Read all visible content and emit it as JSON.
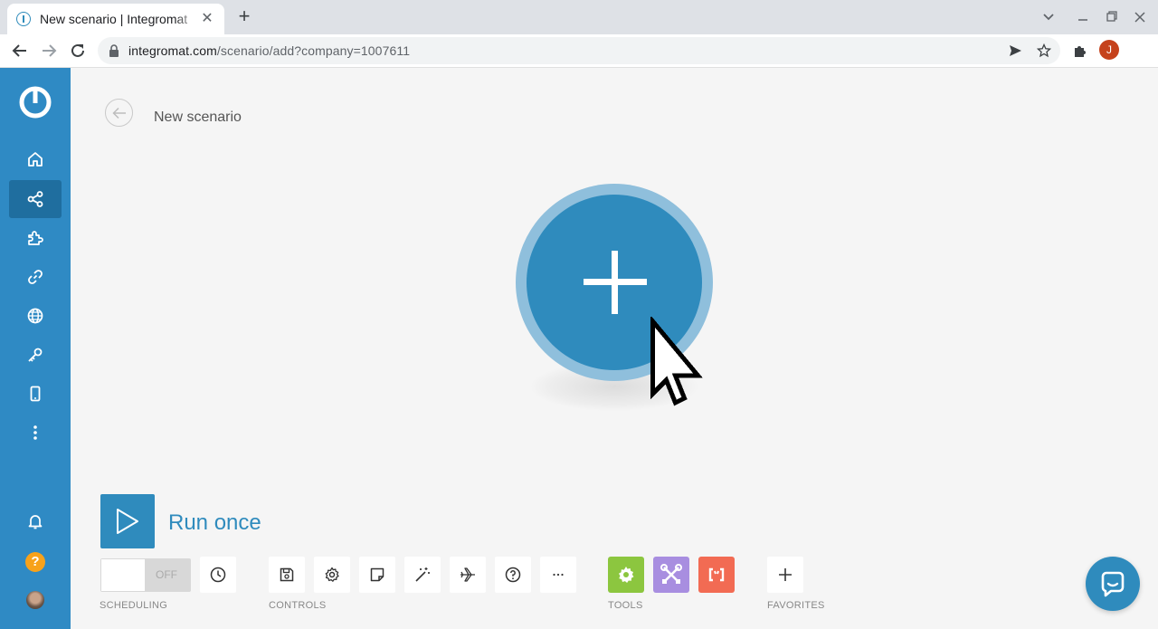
{
  "browser": {
    "tab_title": "New scenario | Integromat",
    "url_host": "integromat.com",
    "url_path": "/scenario/add?company=1007611",
    "profile_initial": "J"
  },
  "sidebar": {
    "items": [
      {
        "icon": "home-icon"
      },
      {
        "icon": "share-icon",
        "active": true
      },
      {
        "icon": "puzzle-icon"
      },
      {
        "icon": "link-icon"
      },
      {
        "icon": "globe-icon"
      },
      {
        "icon": "key-icon"
      },
      {
        "icon": "mobile-icon"
      },
      {
        "icon": "more-vertical-icon"
      }
    ],
    "bottom": [
      {
        "icon": "bell-icon"
      },
      {
        "icon": "help-circle-icon",
        "label": "?"
      },
      {
        "icon": "user-avatar"
      }
    ]
  },
  "header": {
    "title": "New scenario"
  },
  "canvas": {
    "add_button_icon": "plus-icon"
  },
  "bottom_bar": {
    "run_label": "Run once",
    "scheduling": {
      "toggle_text": "OFF",
      "label": "SCHEDULING"
    },
    "controls_label": "CONTROLS",
    "tools_label": "TOOLS",
    "favorites_label": "FAVORITES"
  },
  "colors": {
    "brand": "#2f8bbd",
    "tool_green": "#8cc63f",
    "tool_purple": "#a88ee0",
    "tool_red": "#f26b53"
  }
}
